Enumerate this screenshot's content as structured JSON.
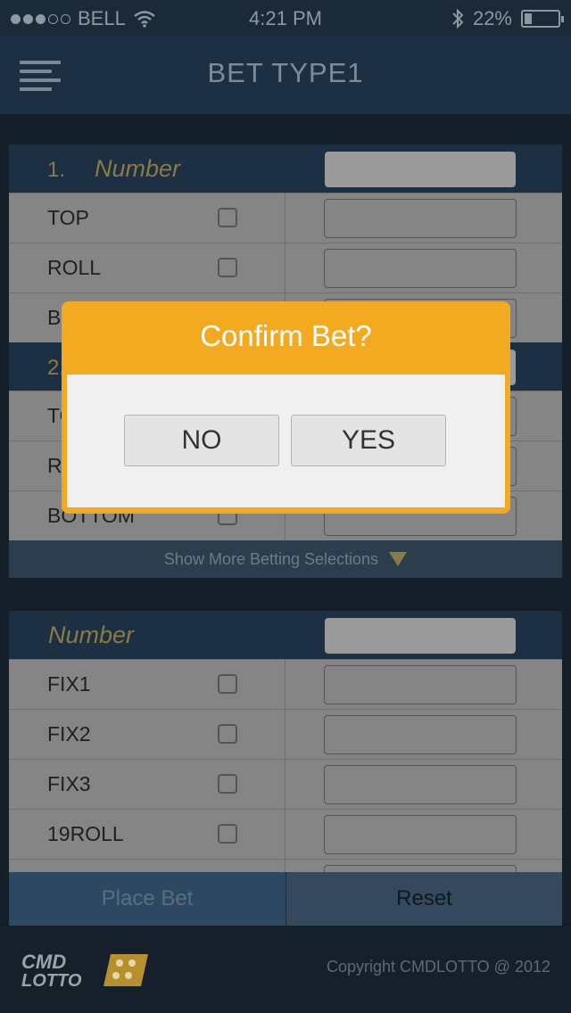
{
  "status_bar": {
    "carrier": "BELL",
    "time": "4:21 PM",
    "battery": "22%",
    "signal_bars": 3,
    "signal_total": 5
  },
  "nav": {
    "title": "BET TYPE1"
  },
  "panel1": {
    "header_index": "1.",
    "header_label": "Number",
    "rows": [
      {
        "label": "TOP"
      },
      {
        "label": "ROLL"
      },
      {
        "label": "BOTTOM"
      }
    ],
    "section2_index": "2.",
    "rows2": [
      {
        "label": "TOP"
      },
      {
        "label": "ROLL"
      },
      {
        "label": "BOTTOM"
      }
    ],
    "show_more": "Show More Betting Selections"
  },
  "panel2": {
    "header_label": "Number",
    "rows": [
      {
        "label": "FIX1"
      },
      {
        "label": "FIX2"
      },
      {
        "label": "FIX3"
      },
      {
        "label": "19ROLL"
      }
    ]
  },
  "actions": {
    "place_bet": "Place Bet",
    "reset": "Reset"
  },
  "footer": {
    "logo_text": "CMD LOTTO",
    "copyright": "Copyright CMDLOTTO @ 2012"
  },
  "dialog": {
    "title": "Confirm Bet?",
    "no": "NO",
    "yes": "YES"
  },
  "colors": {
    "accent": "#f3aa21",
    "header_bg": "#1d3043",
    "gold_text": "#8a7a45"
  }
}
